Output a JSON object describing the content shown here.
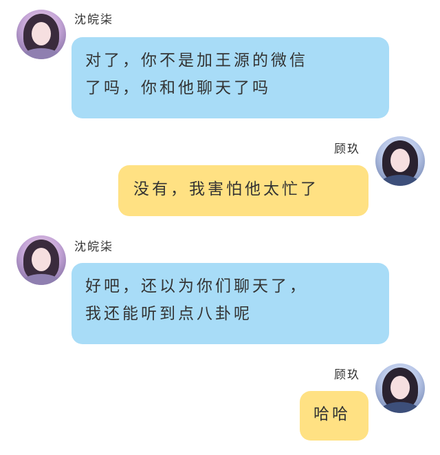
{
  "conversation": {
    "messages": [
      {
        "sender": "沈皖柒",
        "side": "left",
        "bubble_color": "#a8dcf7",
        "lines": [
          "对了，你不是加王源的微信",
          "了吗，你和他聊天了吗"
        ]
      },
      {
        "sender": "顾玖",
        "side": "right",
        "bubble_color": "#ffe183",
        "lines": [
          "没有，我害怕他太忙了"
        ]
      },
      {
        "sender": "沈皖柒",
        "side": "left",
        "bubble_color": "#a8dcf7",
        "lines": [
          "好吧，还以为你们聊天了，",
          "我还能听到点八卦呢"
        ]
      },
      {
        "sender": "顾玖",
        "side": "right",
        "bubble_color": "#ffe183",
        "lines": [
          "哈哈"
        ]
      }
    ]
  }
}
